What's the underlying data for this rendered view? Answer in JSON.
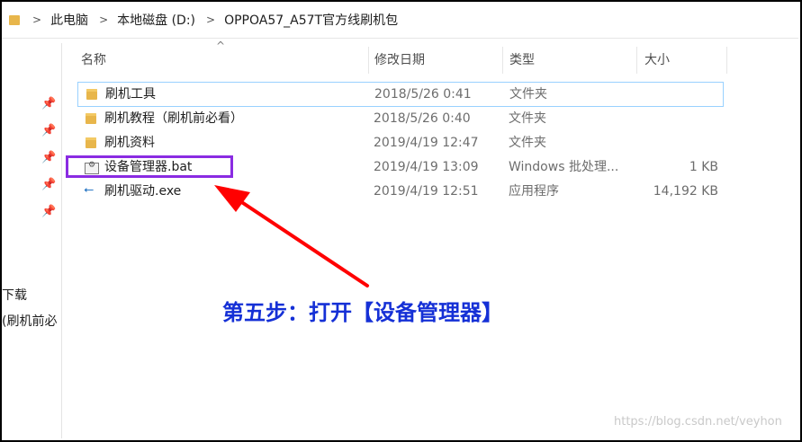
{
  "breadcrumb": [
    "此电脑",
    "本地磁盘 (D:)",
    "OPPOA57_A57T官方线刷机包"
  ],
  "separator": ">",
  "columns": {
    "name": "名称",
    "date": "修改日期",
    "type": "类型",
    "size": "大小"
  },
  "files": [
    {
      "name": "刷机工具",
      "date": "2018/5/26 0:41",
      "type": "文件夹",
      "size": "",
      "icon": "folder-icon"
    },
    {
      "name": "刷机教程（刷机前必看）",
      "date": "2018/5/26 0:40",
      "type": "文件夹",
      "size": "",
      "icon": "folder-icon"
    },
    {
      "name": "刷机资料",
      "date": "2019/4/19 12:47",
      "type": "文件夹",
      "size": "",
      "icon": "folder-icon"
    },
    {
      "name": "设备管理器.bat",
      "date": "2019/4/19 13:09",
      "type": "Windows 批处理...",
      "size": "1 KB",
      "icon": "batch-file-icon"
    },
    {
      "name": "刷机驱动.exe",
      "date": "2019/4/19 12:51",
      "type": "应用程序",
      "size": "14,192 KB",
      "icon": "usb-app-icon"
    }
  ],
  "nav": {
    "item1": "下载",
    "item2": "(刷机前必"
  },
  "annotation": "第五步：打开【设备管理器】",
  "watermark": "https://blog.csdn.net/veyhon",
  "colors": {
    "highlight": "#8a2be2",
    "arrow": "#ff0000",
    "annotation": "#1530d6",
    "selection": "#99d1ff"
  }
}
